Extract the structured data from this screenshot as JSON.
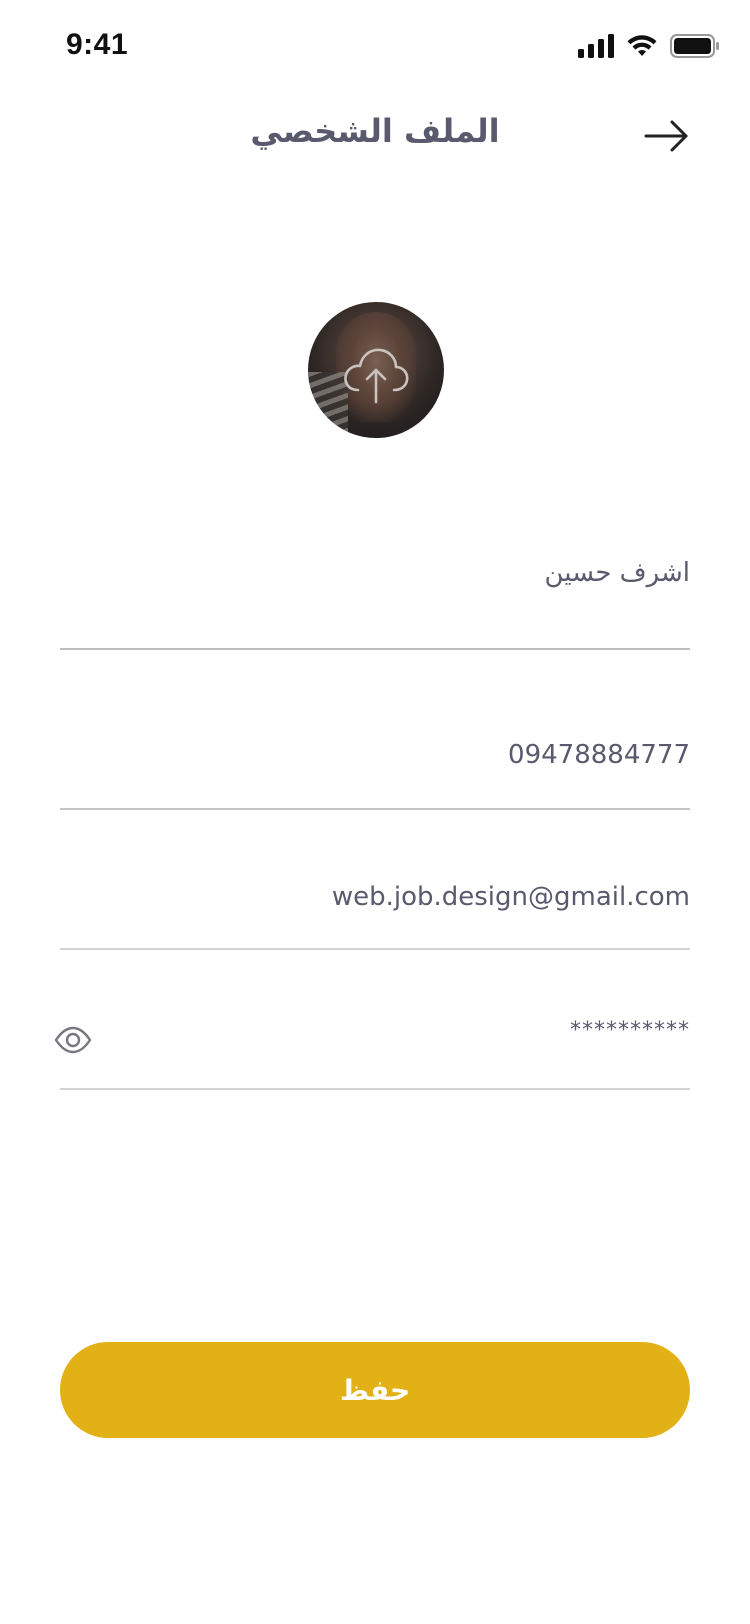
{
  "status_bar": {
    "time": "9:41",
    "icons": [
      "cellular-signal-icon",
      "wifi-icon",
      "battery-icon"
    ]
  },
  "header": {
    "title": "الملف الشخصي",
    "back_icon": "arrow-right-icon"
  },
  "avatar": {
    "overlay_icon": "cloud-upload-icon"
  },
  "form": {
    "name_value": "اشرف حسين",
    "phone_value": "09478884777",
    "email_value": "web.job.design@gmail.com",
    "password_value": "**********",
    "password_toggle_icon": "eye-icon"
  },
  "actions": {
    "save_label": "حفظ"
  },
  "colors": {
    "accent": "#e2b116",
    "text": "#5a5a6e",
    "divider": "#d4d4d8"
  }
}
